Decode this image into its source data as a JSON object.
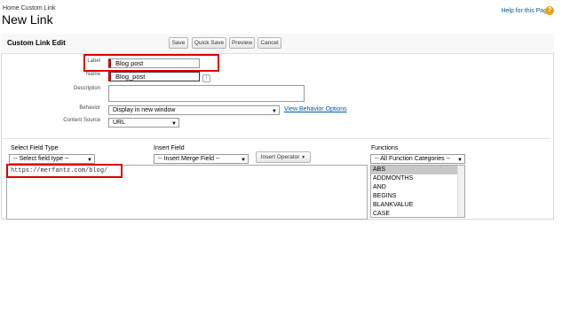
{
  "breadcrumb": "Home Custom Link",
  "page_title": "New Link",
  "help_link": "Help for this Page",
  "section_title": "Custom Link Edit",
  "buttons": {
    "save": "Save",
    "quick_save": "Quick Save",
    "preview": "Preview",
    "cancel": "Cancel"
  },
  "form": {
    "label": {
      "label": "Label",
      "value": "Blog post"
    },
    "name": {
      "label": "Name",
      "value": "Blog_post"
    },
    "description": {
      "label": "Description",
      "value": ""
    },
    "behavior": {
      "label": "Behavior",
      "value": "Display in new window",
      "link": "View Behavior Options"
    },
    "content_source": {
      "label": "Content Source",
      "value": "URL"
    }
  },
  "formula_area": {
    "select_field_type_label": "Select Field Type",
    "select_field_type_value": "-- Select field type --",
    "insert_field_label": "Insert Field",
    "insert_field_value": "-- Insert Merge Field --",
    "insert_operator": "Insert Operator",
    "functions_label": "Functions",
    "functions_category": "-- All Function Categories --",
    "functions": [
      "ABS",
      "ADDMONTHS",
      "AND",
      "BEGINS",
      "BLANKVALUE",
      "CASE"
    ],
    "url_text": "https://merfantz.com/blog/"
  },
  "colors": {
    "required": "#cc0000",
    "highlight": "#e00000",
    "link": "#015ba7"
  }
}
